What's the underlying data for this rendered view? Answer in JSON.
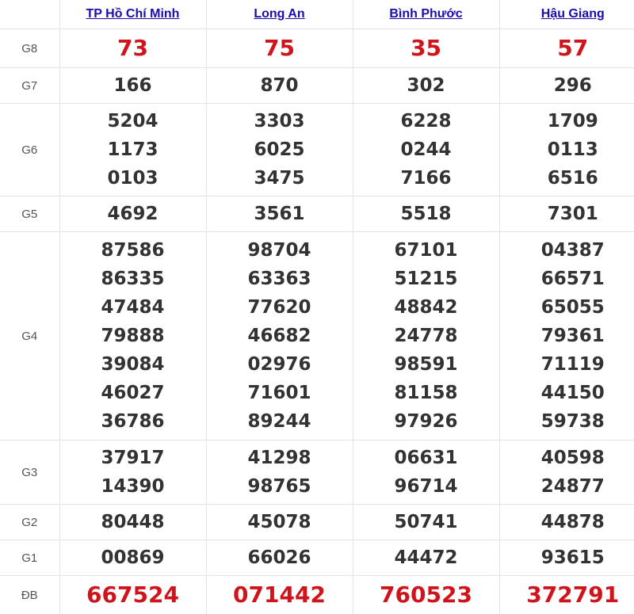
{
  "provinces": [
    "TP Hồ Chí Minh",
    "Long An",
    "Bình Phước",
    "Hậu Giang"
  ],
  "colors": {
    "highlight": "#d0141b",
    "link": "#1a0dab",
    "number": "#333333",
    "label": "#555555"
  },
  "rows": [
    {
      "label": "G8",
      "highlight": true,
      "values": [
        [
          "73"
        ],
        [
          "75"
        ],
        [
          "35"
        ],
        [
          "57"
        ]
      ]
    },
    {
      "label": "G7",
      "highlight": false,
      "values": [
        [
          "166"
        ],
        [
          "870"
        ],
        [
          "302"
        ],
        [
          "296"
        ]
      ]
    },
    {
      "label": "G6",
      "highlight": false,
      "values": [
        [
          "5204",
          "1173",
          "0103"
        ],
        [
          "3303",
          "6025",
          "3475"
        ],
        [
          "6228",
          "0244",
          "7166"
        ],
        [
          "1709",
          "0113",
          "6516"
        ]
      ]
    },
    {
      "label": "G5",
      "highlight": false,
      "values": [
        [
          "4692"
        ],
        [
          "3561"
        ],
        [
          "5518"
        ],
        [
          "7301"
        ]
      ]
    },
    {
      "label": "G4",
      "highlight": false,
      "values": [
        [
          "87586",
          "86335",
          "47484",
          "79888",
          "39084",
          "46027",
          "36786"
        ],
        [
          "98704",
          "63363",
          "77620",
          "46682",
          "02976",
          "71601",
          "89244"
        ],
        [
          "67101",
          "51215",
          "48842",
          "24778",
          "98591",
          "81158",
          "97926"
        ],
        [
          "04387",
          "66571",
          "65055",
          "79361",
          "71119",
          "44150",
          "59738"
        ]
      ]
    },
    {
      "label": "G3",
      "highlight": false,
      "values": [
        [
          "37917",
          "14390"
        ],
        [
          "41298",
          "98765"
        ],
        [
          "06631",
          "96714"
        ],
        [
          "40598",
          "24877"
        ]
      ]
    },
    {
      "label": "G2",
      "highlight": false,
      "values": [
        [
          "80448"
        ],
        [
          "45078"
        ],
        [
          "50741"
        ],
        [
          "44878"
        ]
      ]
    },
    {
      "label": "G1",
      "highlight": false,
      "values": [
        [
          "00869"
        ],
        [
          "66026"
        ],
        [
          "44472"
        ],
        [
          "93615"
        ]
      ]
    },
    {
      "label": "ĐB",
      "highlight": true,
      "values": [
        [
          "667524"
        ],
        [
          "071442"
        ],
        [
          "760523"
        ],
        [
          "372791"
        ]
      ]
    }
  ]
}
